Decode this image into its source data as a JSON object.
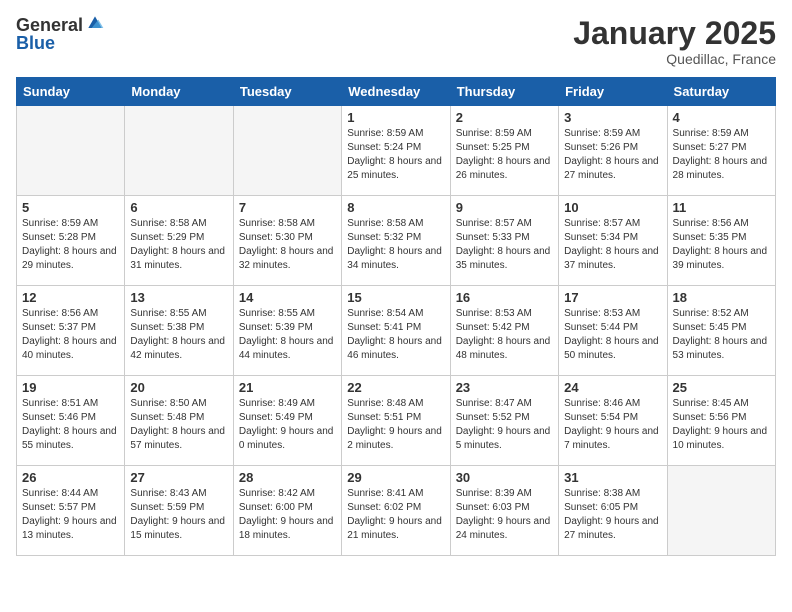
{
  "header": {
    "logo_general": "General",
    "logo_blue": "Blue",
    "title": "January 2025",
    "subtitle": "Quedillac, France"
  },
  "days_of_week": [
    "Sunday",
    "Monday",
    "Tuesday",
    "Wednesday",
    "Thursday",
    "Friday",
    "Saturday"
  ],
  "weeks": [
    [
      {
        "day": "",
        "sunrise": "",
        "sunset": "",
        "daylight": "",
        "empty": true
      },
      {
        "day": "",
        "sunrise": "",
        "sunset": "",
        "daylight": "",
        "empty": true
      },
      {
        "day": "",
        "sunrise": "",
        "sunset": "",
        "daylight": "",
        "empty": true
      },
      {
        "day": "1",
        "sunrise": "Sunrise: 8:59 AM",
        "sunset": "Sunset: 5:24 PM",
        "daylight": "Daylight: 8 hours and 25 minutes.",
        "empty": false
      },
      {
        "day": "2",
        "sunrise": "Sunrise: 8:59 AM",
        "sunset": "Sunset: 5:25 PM",
        "daylight": "Daylight: 8 hours and 26 minutes.",
        "empty": false
      },
      {
        "day": "3",
        "sunrise": "Sunrise: 8:59 AM",
        "sunset": "Sunset: 5:26 PM",
        "daylight": "Daylight: 8 hours and 27 minutes.",
        "empty": false
      },
      {
        "day": "4",
        "sunrise": "Sunrise: 8:59 AM",
        "sunset": "Sunset: 5:27 PM",
        "daylight": "Daylight: 8 hours and 28 minutes.",
        "empty": false
      }
    ],
    [
      {
        "day": "5",
        "sunrise": "Sunrise: 8:59 AM",
        "sunset": "Sunset: 5:28 PM",
        "daylight": "Daylight: 8 hours and 29 minutes.",
        "empty": false
      },
      {
        "day": "6",
        "sunrise": "Sunrise: 8:58 AM",
        "sunset": "Sunset: 5:29 PM",
        "daylight": "Daylight: 8 hours and 31 minutes.",
        "empty": false
      },
      {
        "day": "7",
        "sunrise": "Sunrise: 8:58 AM",
        "sunset": "Sunset: 5:30 PM",
        "daylight": "Daylight: 8 hours and 32 minutes.",
        "empty": false
      },
      {
        "day": "8",
        "sunrise": "Sunrise: 8:58 AM",
        "sunset": "Sunset: 5:32 PM",
        "daylight": "Daylight: 8 hours and 34 minutes.",
        "empty": false
      },
      {
        "day": "9",
        "sunrise": "Sunrise: 8:57 AM",
        "sunset": "Sunset: 5:33 PM",
        "daylight": "Daylight: 8 hours and 35 minutes.",
        "empty": false
      },
      {
        "day": "10",
        "sunrise": "Sunrise: 8:57 AM",
        "sunset": "Sunset: 5:34 PM",
        "daylight": "Daylight: 8 hours and 37 minutes.",
        "empty": false
      },
      {
        "day": "11",
        "sunrise": "Sunrise: 8:56 AM",
        "sunset": "Sunset: 5:35 PM",
        "daylight": "Daylight: 8 hours and 39 minutes.",
        "empty": false
      }
    ],
    [
      {
        "day": "12",
        "sunrise": "Sunrise: 8:56 AM",
        "sunset": "Sunset: 5:37 PM",
        "daylight": "Daylight: 8 hours and 40 minutes.",
        "empty": false
      },
      {
        "day": "13",
        "sunrise": "Sunrise: 8:55 AM",
        "sunset": "Sunset: 5:38 PM",
        "daylight": "Daylight: 8 hours and 42 minutes.",
        "empty": false
      },
      {
        "day": "14",
        "sunrise": "Sunrise: 8:55 AM",
        "sunset": "Sunset: 5:39 PM",
        "daylight": "Daylight: 8 hours and 44 minutes.",
        "empty": false
      },
      {
        "day": "15",
        "sunrise": "Sunrise: 8:54 AM",
        "sunset": "Sunset: 5:41 PM",
        "daylight": "Daylight: 8 hours and 46 minutes.",
        "empty": false
      },
      {
        "day": "16",
        "sunrise": "Sunrise: 8:53 AM",
        "sunset": "Sunset: 5:42 PM",
        "daylight": "Daylight: 8 hours and 48 minutes.",
        "empty": false
      },
      {
        "day": "17",
        "sunrise": "Sunrise: 8:53 AM",
        "sunset": "Sunset: 5:44 PM",
        "daylight": "Daylight: 8 hours and 50 minutes.",
        "empty": false
      },
      {
        "day": "18",
        "sunrise": "Sunrise: 8:52 AM",
        "sunset": "Sunset: 5:45 PM",
        "daylight": "Daylight: 8 hours and 53 minutes.",
        "empty": false
      }
    ],
    [
      {
        "day": "19",
        "sunrise": "Sunrise: 8:51 AM",
        "sunset": "Sunset: 5:46 PM",
        "daylight": "Daylight: 8 hours and 55 minutes.",
        "empty": false
      },
      {
        "day": "20",
        "sunrise": "Sunrise: 8:50 AM",
        "sunset": "Sunset: 5:48 PM",
        "daylight": "Daylight: 8 hours and 57 minutes.",
        "empty": false
      },
      {
        "day": "21",
        "sunrise": "Sunrise: 8:49 AM",
        "sunset": "Sunset: 5:49 PM",
        "daylight": "Daylight: 9 hours and 0 minutes.",
        "empty": false
      },
      {
        "day": "22",
        "sunrise": "Sunrise: 8:48 AM",
        "sunset": "Sunset: 5:51 PM",
        "daylight": "Daylight: 9 hours and 2 minutes.",
        "empty": false
      },
      {
        "day": "23",
        "sunrise": "Sunrise: 8:47 AM",
        "sunset": "Sunset: 5:52 PM",
        "daylight": "Daylight: 9 hours and 5 minutes.",
        "empty": false
      },
      {
        "day": "24",
        "sunrise": "Sunrise: 8:46 AM",
        "sunset": "Sunset: 5:54 PM",
        "daylight": "Daylight: 9 hours and 7 minutes.",
        "empty": false
      },
      {
        "day": "25",
        "sunrise": "Sunrise: 8:45 AM",
        "sunset": "Sunset: 5:56 PM",
        "daylight": "Daylight: 9 hours and 10 minutes.",
        "empty": false
      }
    ],
    [
      {
        "day": "26",
        "sunrise": "Sunrise: 8:44 AM",
        "sunset": "Sunset: 5:57 PM",
        "daylight": "Daylight: 9 hours and 13 minutes.",
        "empty": false
      },
      {
        "day": "27",
        "sunrise": "Sunrise: 8:43 AM",
        "sunset": "Sunset: 5:59 PM",
        "daylight": "Daylight: 9 hours and 15 minutes.",
        "empty": false
      },
      {
        "day": "28",
        "sunrise": "Sunrise: 8:42 AM",
        "sunset": "Sunset: 6:00 PM",
        "daylight": "Daylight: 9 hours and 18 minutes.",
        "empty": false
      },
      {
        "day": "29",
        "sunrise": "Sunrise: 8:41 AM",
        "sunset": "Sunset: 6:02 PM",
        "daylight": "Daylight: 9 hours and 21 minutes.",
        "empty": false
      },
      {
        "day": "30",
        "sunrise": "Sunrise: 8:39 AM",
        "sunset": "Sunset: 6:03 PM",
        "daylight": "Daylight: 9 hours and 24 minutes.",
        "empty": false
      },
      {
        "day": "31",
        "sunrise": "Sunrise: 8:38 AM",
        "sunset": "Sunset: 6:05 PM",
        "daylight": "Daylight: 9 hours and 27 minutes.",
        "empty": false
      },
      {
        "day": "",
        "sunrise": "",
        "sunset": "",
        "daylight": "",
        "empty": true
      }
    ]
  ]
}
